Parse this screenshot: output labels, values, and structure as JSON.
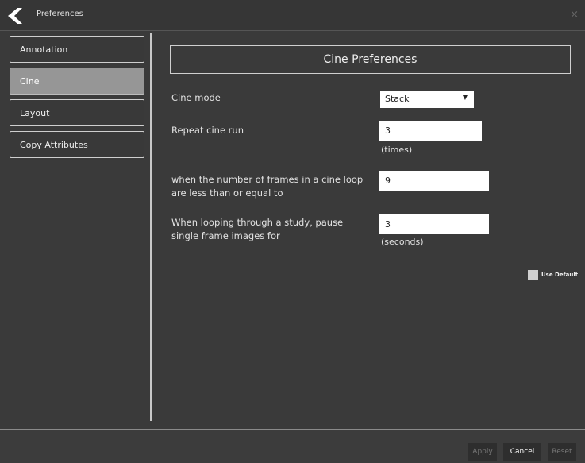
{
  "window": {
    "title": "Preferences",
    "close_glyph": "×"
  },
  "sidebar": {
    "items": [
      {
        "label": "Annotation"
      },
      {
        "label": "Cine",
        "active": true
      },
      {
        "label": "Layout"
      },
      {
        "label": "Copy Attributes"
      }
    ]
  },
  "main": {
    "heading": "Cine Preferences",
    "cine_mode": {
      "label": "Cine mode",
      "value": "Stack",
      "arrow": "▼"
    },
    "repeat": {
      "label": "Repeat cine run",
      "value": "3",
      "unit": "(times)"
    },
    "frames": {
      "label_line1": "when the number of frames in a cine loop",
      "label_line2": "are less than or equal to",
      "value": "9"
    },
    "pause": {
      "label_line1": "When looping through a study, pause",
      "label_line2": "single frame images for",
      "value": "3",
      "unit": "(seconds)"
    },
    "use_default": {
      "label": "Use Default",
      "checked": false
    }
  },
  "footer": {
    "apply_label": "Apply",
    "cancel_label": "Cancel",
    "reset_label": "Reset"
  },
  "icons": {
    "back": "back-arrow-icon",
    "close": "close-icon"
  },
  "colors": {
    "background": "#3a3a3a",
    "active_tab": "#969696",
    "input_bg": "#ffffff"
  }
}
